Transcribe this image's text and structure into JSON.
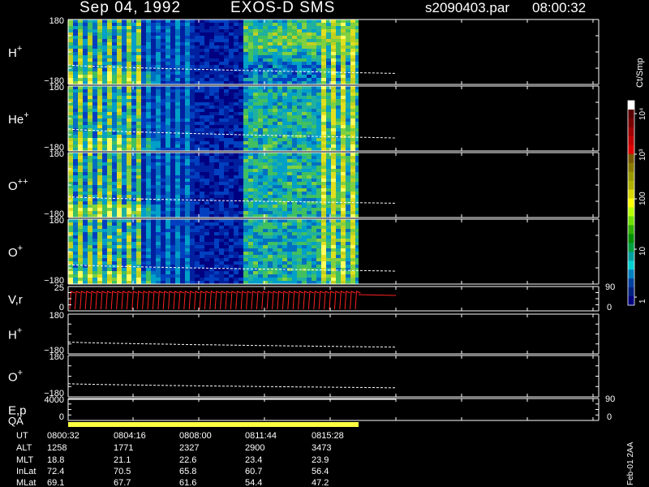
{
  "header": {
    "date": "Sep 04, 1992",
    "mission": "EXOS-D SMS",
    "file": "s2090403.par",
    "time": "08:00:32"
  },
  "colorbar": {
    "unit": "Ct/Smp",
    "ticks": [
      "10⁴",
      "10³",
      "100",
      "10",
      "1"
    ],
    "colors": [
      "#ffffff",
      "#5a0000",
      "#7a0000",
      "#a00000",
      "#c00000",
      "#e00000",
      "#7a5a00",
      "#8a7a00",
      "#9a9a00",
      "#b0b000",
      "#d8d800",
      "#ffff00",
      "#b8ff00",
      "#70e000",
      "#30b000",
      "#009000",
      "#00a040",
      "#00a0a0",
      "#00d0d0",
      "#0080c0",
      "#0040a0",
      "#002080",
      "#000080"
    ]
  },
  "panels": [
    {
      "label": "H",
      "sup": "+",
      "top": "180",
      "bottom": "−180",
      "kind": "spec"
    },
    {
      "label": "He",
      "sup": "+",
      "top": "180",
      "bottom": "−180",
      "kind": "spec"
    },
    {
      "label": "O",
      "sup": "++",
      "top": "180",
      "bottom": "−180",
      "kind": "spec"
    },
    {
      "label": "O",
      "sup": "+",
      "top": "180",
      "bottom": "−180",
      "kind": "spec"
    },
    {
      "label": "V,r",
      "sup": "",
      "top": "25",
      "bottom": "0",
      "kind": "vr",
      "right_top": "90",
      "right_bottom": "0"
    },
    {
      "label": "H",
      "sup": "+",
      "top": "180",
      "bottom": "−180",
      "kind": "line"
    },
    {
      "label": "O",
      "sup": "+",
      "top": "180",
      "bottom": "−180",
      "kind": "line"
    },
    {
      "label": "E,p",
      "sup": "",
      "top": "4000",
      "bottom": "0",
      "kind": "ep",
      "right_top": "90",
      "right_bottom": "0"
    }
  ],
  "qa_label": "QA",
  "orbit_table": {
    "row_labels": [
      "UT",
      "ALT",
      "MLT",
      "InLat",
      "MLat"
    ],
    "columns": [
      [
        "0800:32",
        "1258",
        "18.8",
        "72.4",
        "69.1"
      ],
      [
        "0804:16",
        "1771",
        "21.1",
        "70.5",
        "67.7"
      ],
      [
        "0808:00",
        "2327",
        "22.6",
        "65.8",
        "61.6"
      ],
      [
        "0811:44",
        "2900",
        "23.4",
        "60.7",
        "54.4"
      ],
      [
        "0815:28",
        "3473",
        "23.9",
        "56.4",
        "47.2"
      ]
    ]
  },
  "footer_note": "Feb-01 2AA",
  "chart_data": {
    "type": "heatmap",
    "title": "Sep 04, 1992   EXOS-D SMS",
    "x_tick_labels": [
      "0800:32",
      "0804:16",
      "0808:00",
      "0811:44",
      "0815:28"
    ],
    "y_range": [
      -180,
      180
    ],
    "series": [
      "H+",
      "He+",
      "O++",
      "O+"
    ],
    "colorbar_range_ct_per_smp": [
      1,
      10000
    ],
    "data_end_tick_fraction": 4.5,
    "pitch_line_tracks": [
      {
        "name": "H+",
        "values": [
          -95,
          -120,
          -140,
          -150,
          -150,
          -148
        ]
      },
      {
        "name": "O+",
        "values": [
          -70,
          -95,
          -115,
          -120,
          -122,
          -120
        ]
      }
    ]
  }
}
